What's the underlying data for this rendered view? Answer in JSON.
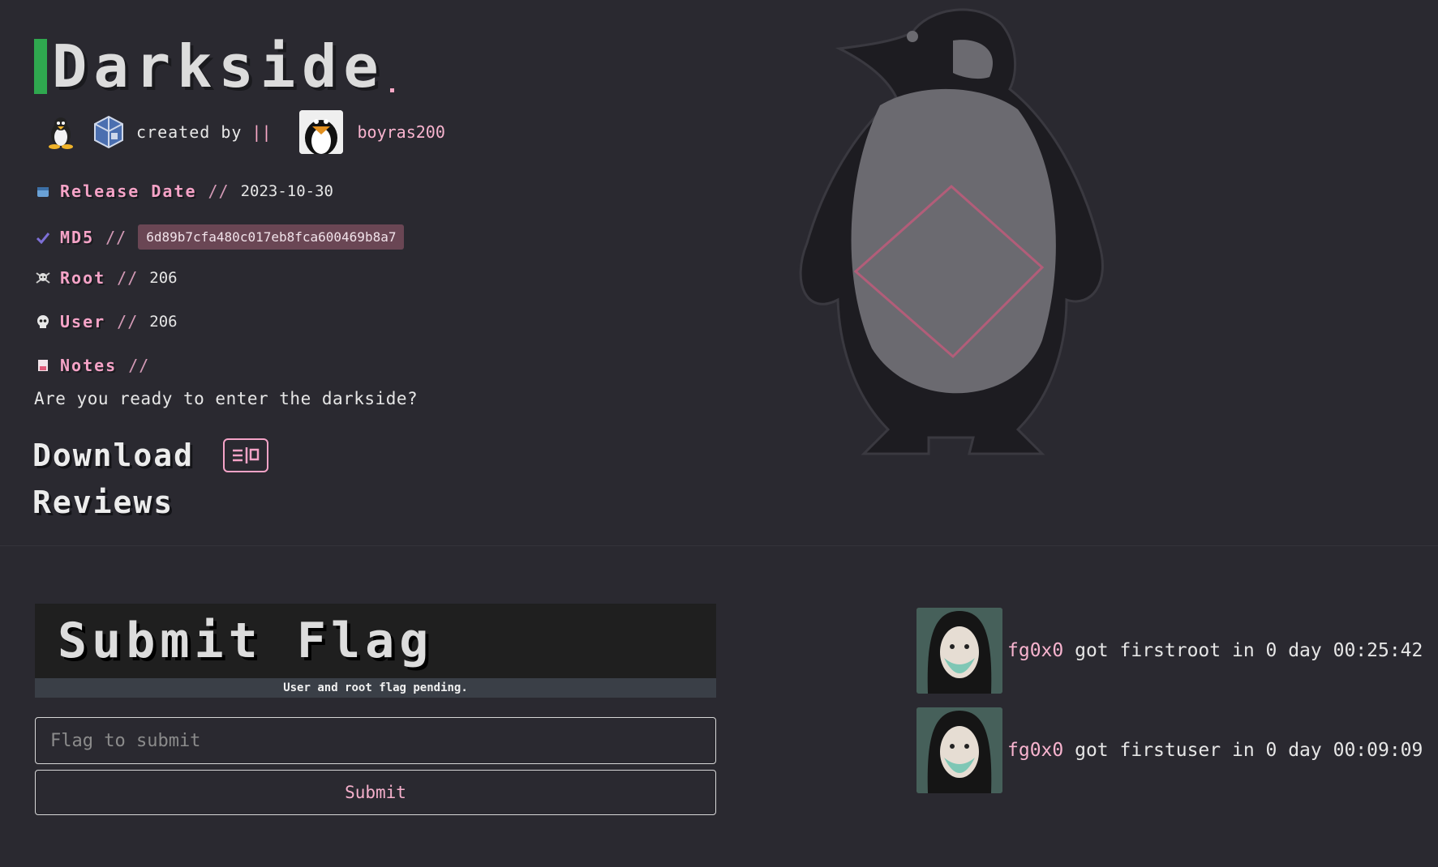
{
  "machine": {
    "title": "Darkside",
    "created_by_label": "created by",
    "separator": "||",
    "creator_name": "boyras200"
  },
  "info": {
    "release_label": "Release Date",
    "release_value": "2023-10-30",
    "md5_label": "MD5",
    "md5_value": "6d89b7cfa480c017eb8fca600469b8a7",
    "root_label": "Root",
    "root_value": "206",
    "user_label": "User",
    "user_value": "206",
    "notes_label": "Notes",
    "separator": "//",
    "notes_text": "Are you ready to enter the darkside?"
  },
  "links": {
    "download_label": "Download",
    "reviews_label": "Reviews"
  },
  "flag": {
    "title": "Submit Flag",
    "status": "User and root flag pending.",
    "placeholder": "Flag to submit",
    "submit_label": "Submit"
  },
  "activity": [
    {
      "user": "fg0x0",
      "text": "got firstroot in 0 day 00:25:42"
    },
    {
      "user": "fg0x0",
      "text": "got firstuser in 0 day 00:09:09"
    }
  ],
  "colors": {
    "background": "#2a2930",
    "accent_pink": "#f5a3c7",
    "title_bar_green": "#2fa84f",
    "md5_badge": "#6a4654"
  },
  "icons": {
    "os": "tux-linux-icon",
    "hypervisor": "virtualbox-icon",
    "release": "calendar-icon",
    "md5": "checkmark-icon",
    "root": "skull-crossbones-icon",
    "user": "skull-icon",
    "notes": "note-icon",
    "download": "download-icon"
  }
}
